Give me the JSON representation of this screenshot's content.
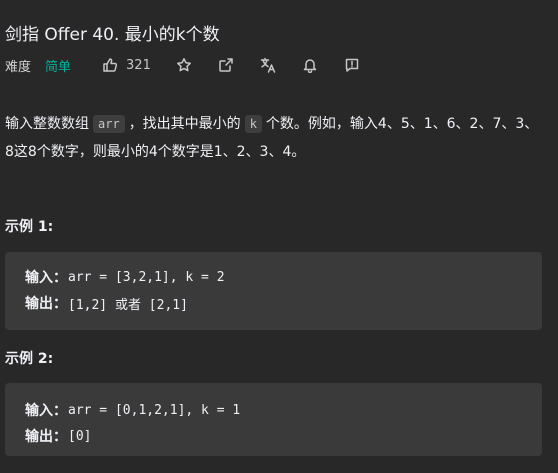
{
  "problem": {
    "title": "剑指 Offer 40. 最小的k个数",
    "difficulty_label": "难度",
    "difficulty_value": "简单",
    "like_count": "321",
    "colors": {
      "difficulty": "#00af9b"
    }
  },
  "description": {
    "part1": "输入整数数组",
    "code1": "arr",
    "part2": "，找出其中最小的",
    "code2": "k",
    "part3": "个数。例如，输入4、5、1、6、2、7、3、8这8个数字，则最小的4个数字是1、2、3、4。"
  },
  "examples": [
    {
      "title": "示例 1:",
      "input_label": "输入：",
      "input_value": "arr = [3,2,1], k = 2",
      "output_label": "输出：",
      "output_value": "[1,2] 或者 [2,1]"
    },
    {
      "title": "示例 2:",
      "input_label": "输入：",
      "input_value": "arr = [0,1,2,1], k = 1",
      "output_label": "输出：",
      "output_value": "[0]"
    }
  ],
  "icons": [
    "thumbs-up-icon",
    "star-icon",
    "share-icon",
    "translate-icon",
    "bell-icon",
    "feedback-icon"
  ]
}
